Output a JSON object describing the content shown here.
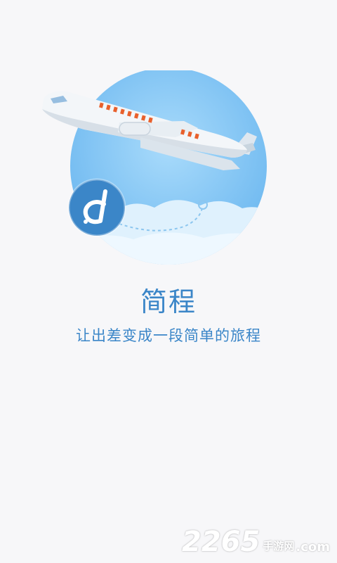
{
  "app": {
    "title": "简程",
    "tagline": "让出差变成一段简单的旅程"
  },
  "hero": {
    "illustration": "airplane-over-sky-circle",
    "logo_icon": "jianc-logo-icon",
    "colors": {
      "sky": "#7fc4f5",
      "sky_light": "#dff1fd",
      "logo_blue": "#3b86c8",
      "plane_window": "#e8602c"
    }
  },
  "watermark": {
    "number": "2265",
    "label": "手游网",
    "suffix": ".com"
  }
}
